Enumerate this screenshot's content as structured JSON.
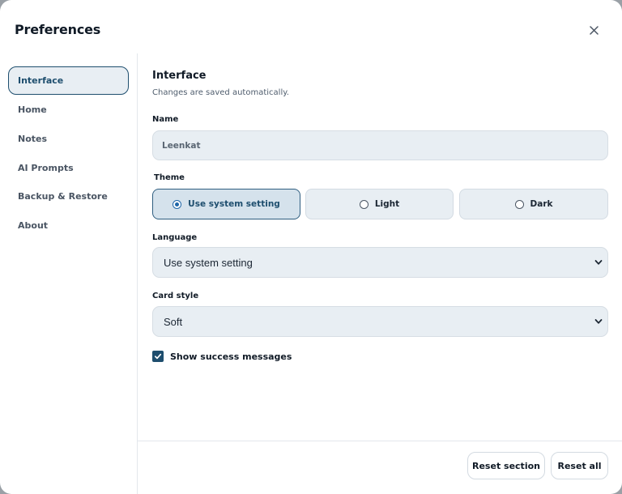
{
  "dialog": {
    "title": "Preferences",
    "close_icon": "close-icon"
  },
  "sidebar": {
    "items": [
      {
        "label": "Interface",
        "active": true
      },
      {
        "label": "Home",
        "active": false
      },
      {
        "label": "Notes",
        "active": false
      },
      {
        "label": "AI Prompts",
        "active": false
      },
      {
        "label": "Backup & Restore",
        "active": false
      },
      {
        "label": "About",
        "active": false
      }
    ]
  },
  "section": {
    "title": "Interface",
    "subtitle": "Changes are saved automatically."
  },
  "name_field": {
    "label": "Name",
    "value": "Leenkat"
  },
  "theme": {
    "label": "Theme",
    "options": [
      {
        "label": "Use system setting",
        "selected": true
      },
      {
        "label": "Light",
        "selected": false
      },
      {
        "label": "Dark",
        "selected": false
      }
    ]
  },
  "language": {
    "label": "Language",
    "value": "Use system setting"
  },
  "card_style": {
    "label": "Card style",
    "value": "Soft"
  },
  "success_messages": {
    "label": "Show success messages",
    "checked": true
  },
  "footer": {
    "reset_section": "Reset section",
    "reset_all": "Reset all"
  },
  "colors": {
    "accent": "#1e4e6e",
    "field_bg": "#e8eef3",
    "selected_bg": "#d5e2ec"
  }
}
